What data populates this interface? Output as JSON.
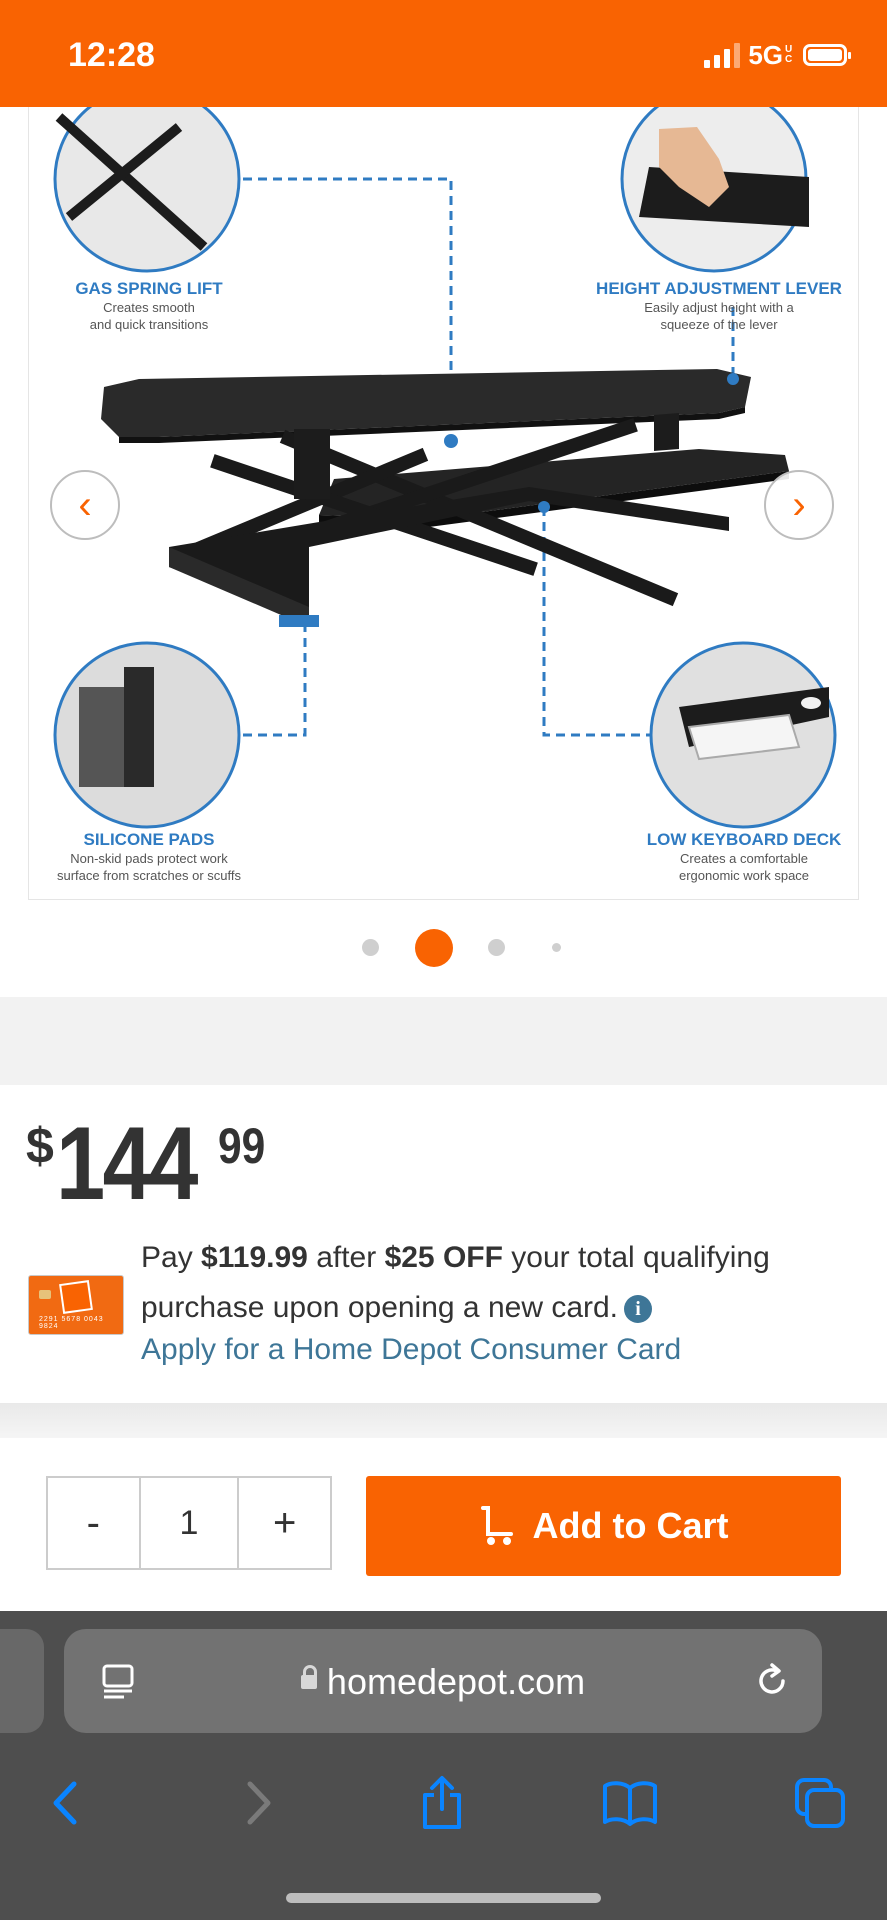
{
  "status_bar": {
    "time": "12:28",
    "network": "5G",
    "network_suffix": "UC"
  },
  "gallery": {
    "callouts": [
      {
        "title": "GAS SPRING LIFT",
        "line1": "Creates smooth",
        "line2": "and quick transitions"
      },
      {
        "title": "HEIGHT ADJUSTMENT LEVER",
        "line1": "Easily adjust height with a",
        "line2": "squeeze of the lever"
      },
      {
        "title": "SILICONE PADS",
        "line1": "Non-skid pads protect work",
        "line2": "surface from scratches or scuffs"
      },
      {
        "title": "LOW KEYBOARD DECK",
        "line1": "Creates a comfortable",
        "line2": "ergonomic work space"
      }
    ],
    "prev_label": "‹",
    "next_label": "›",
    "active_slide": 2,
    "slide_count": 4
  },
  "price": {
    "currency": "$",
    "dollars": "144",
    "cents": "99"
  },
  "promo": {
    "pay": "Pay",
    "amount": "$119.99",
    "after": "after",
    "discount": "$25 OFF",
    "rest": "your total qualifying purchase upon opening a new card.",
    "info_glyph": "i",
    "link": "Apply for a Home Depot Consumer Card",
    "card_number": "2291 5678 0043 9824"
  },
  "cart": {
    "minus": "-",
    "quantity": "1",
    "plus": "+",
    "add_label": "Add to Cart"
  },
  "browser": {
    "url": "homedepot.com"
  },
  "colors": {
    "brand_orange": "#f96302",
    "link_blue": "#3e7697",
    "ios_blue": "#0a84ff"
  }
}
